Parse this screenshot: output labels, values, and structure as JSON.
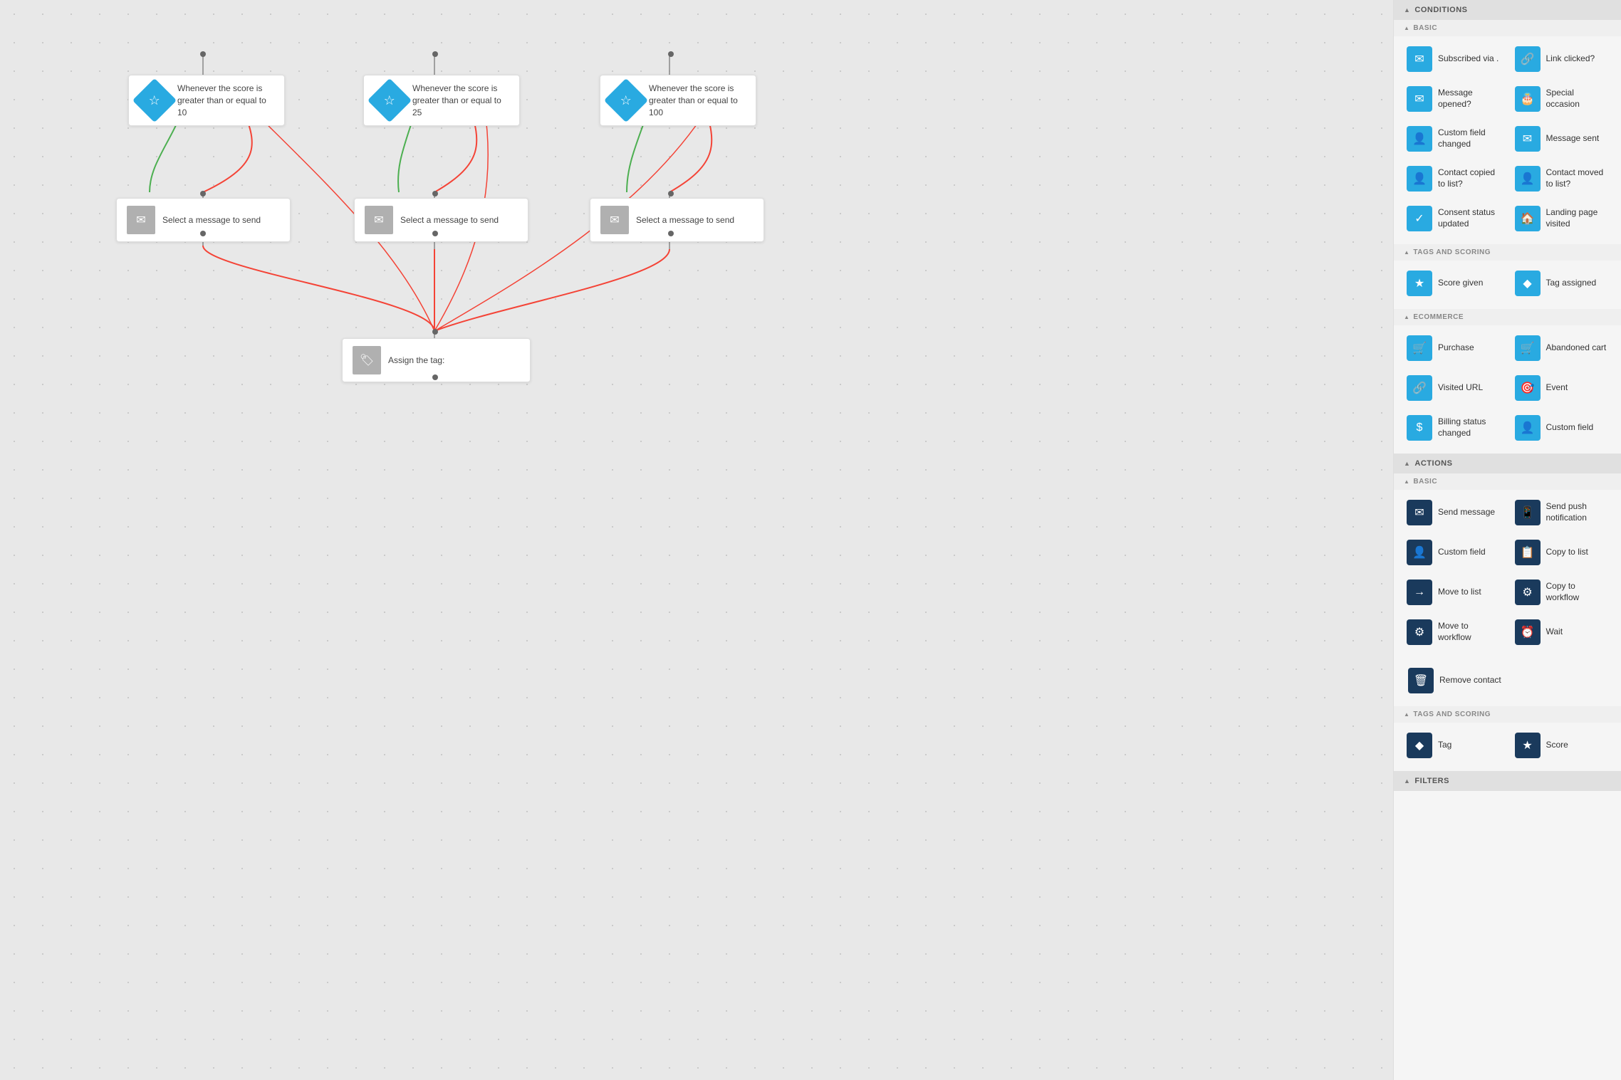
{
  "sidebar": {
    "conditions_label": "CONDITIONS",
    "actions_label": "ACTIONS",
    "filters_label": "FILTERS",
    "basic_label": "BASIC",
    "tags_scoring_label": "TAGS AND SCORING",
    "ecommerce_label": "ECOMMERCE",
    "conditions_basic": [
      {
        "id": "subscribed-via",
        "label": "Subscribed via .",
        "icon": "✉",
        "color": "cyan"
      },
      {
        "id": "link-clicked",
        "label": "Link clicked?",
        "icon": "🔗",
        "color": "cyan"
      },
      {
        "id": "message-opened",
        "label": "Message opened?",
        "icon": "✉",
        "color": "cyan"
      },
      {
        "id": "special-occasion",
        "label": "Special occasion",
        "icon": "🎂",
        "color": "cyan"
      },
      {
        "id": "custom-field-changed",
        "label": "Custom field changed",
        "icon": "👤",
        "color": "cyan"
      },
      {
        "id": "message-sent",
        "label": "Message sent",
        "icon": "✉",
        "color": "cyan"
      },
      {
        "id": "contact-copied-to-list",
        "label": "Contact copied to list?",
        "icon": "👤",
        "color": "cyan"
      },
      {
        "id": "contact-moved-to-list",
        "label": "Contact moved to list?",
        "icon": "👤",
        "color": "cyan"
      },
      {
        "id": "consent-status-updated",
        "label": "Consent status updated",
        "icon": "✓",
        "color": "cyan"
      },
      {
        "id": "landing-page-visited",
        "label": "Landing page visited",
        "icon": "🏠",
        "color": "cyan"
      }
    ],
    "conditions_tags": [
      {
        "id": "score-given",
        "label": "Score given",
        "icon": "★",
        "color": "cyan"
      },
      {
        "id": "tag-assigned",
        "label": "Tag assigned",
        "icon": "◆",
        "color": "cyan"
      }
    ],
    "conditions_ecommerce": [
      {
        "id": "purchase",
        "label": "Purchase",
        "icon": "🛒",
        "color": "cyan"
      },
      {
        "id": "abandoned-cart",
        "label": "Abandoned cart",
        "icon": "🛒",
        "color": "cyan"
      },
      {
        "id": "visited-url",
        "label": "Visited URL",
        "icon": "🔗",
        "color": "cyan"
      },
      {
        "id": "event",
        "label": "Event",
        "icon": "🎯",
        "color": "cyan"
      },
      {
        "id": "billing-status-changed",
        "label": "Billing status changed",
        "icon": "$",
        "color": "cyan"
      },
      {
        "id": "custom-field",
        "label": "Custom field",
        "icon": "👤",
        "color": "cyan"
      }
    ],
    "actions_basic": [
      {
        "id": "send-message",
        "label": "Send message",
        "icon": "✉",
        "color": "dark"
      },
      {
        "id": "send-push-notification",
        "label": "Send push notification",
        "icon": "📱",
        "color": "dark"
      },
      {
        "id": "custom-field-action",
        "label": "Custom field",
        "icon": "👤",
        "color": "dark"
      },
      {
        "id": "copy-to-list",
        "label": "Copy to list",
        "icon": "📋",
        "color": "dark"
      },
      {
        "id": "move-to-list",
        "label": "Move to list",
        "icon": "→",
        "color": "dark"
      },
      {
        "id": "copy-to-workflow",
        "label": "Copy to workflow",
        "icon": "⚙",
        "color": "dark"
      },
      {
        "id": "move-to-workflow",
        "label": "Move to workflow",
        "icon": "⚙",
        "color": "dark"
      },
      {
        "id": "wait",
        "label": "Wait",
        "icon": "⏰",
        "color": "dark"
      },
      {
        "id": "remove-contact",
        "label": "Remove contact",
        "icon": "🗑",
        "color": "dark"
      }
    ],
    "actions_tags": [
      {
        "id": "tag",
        "label": "Tag",
        "icon": "◆",
        "color": "dark"
      },
      {
        "id": "score",
        "label": "Score",
        "icon": "★",
        "color": "dark"
      }
    ]
  },
  "nodes": {
    "condition1": {
      "text": "Whenever the score is greater than or equal to 10"
    },
    "condition2": {
      "text": "Whenever the score is greater than or equal to 25"
    },
    "condition3": {
      "text": "Whenever the score is greater than or equal to 100"
    },
    "message1": {
      "text": "Select a message to send"
    },
    "message2": {
      "text": "Select a message to send"
    },
    "message3": {
      "text": "Select a message to send"
    },
    "tag1": {
      "text": "Assign the tag:"
    }
  }
}
